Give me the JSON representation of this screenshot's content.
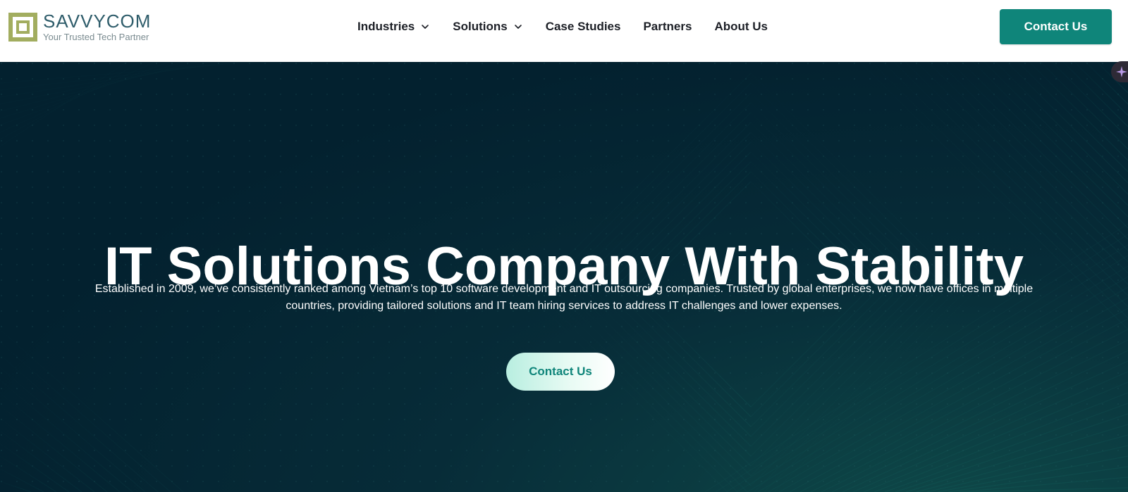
{
  "brand": {
    "name": "SAVVYCOM",
    "tagline": "Your Trusted Tech Partner",
    "logo_color": "#a2ad5f",
    "name_color": "#2f5d6b"
  },
  "nav": {
    "items": [
      {
        "label": "Industries",
        "has_dropdown": true
      },
      {
        "label": "Solutions",
        "has_dropdown": true
      },
      {
        "label": "Case Studies",
        "has_dropdown": false
      },
      {
        "label": "Partners",
        "has_dropdown": false
      },
      {
        "label": "About Us",
        "has_dropdown": false
      }
    ],
    "cta_label": "Contact Us",
    "cta_color": "#0f857a"
  },
  "hero": {
    "title": "IT Solutions Company With Stability",
    "description": "Established in 2009, we’ve consistently ranked among Vietnam’s top 10 software development and IT outsourcing companies. Trusted by global enterprises, we now have offices in multiple countries, providing tailored solutions and IT team hiring services to address IT challenges and lower expenses.",
    "cta_label": "Contact Us",
    "background_color": "#03212f",
    "accent_color": "#1fb39b"
  },
  "icons": {
    "nav_dropdown": "chevron-down-icon",
    "floating_widget": "sparkle-icon"
  }
}
